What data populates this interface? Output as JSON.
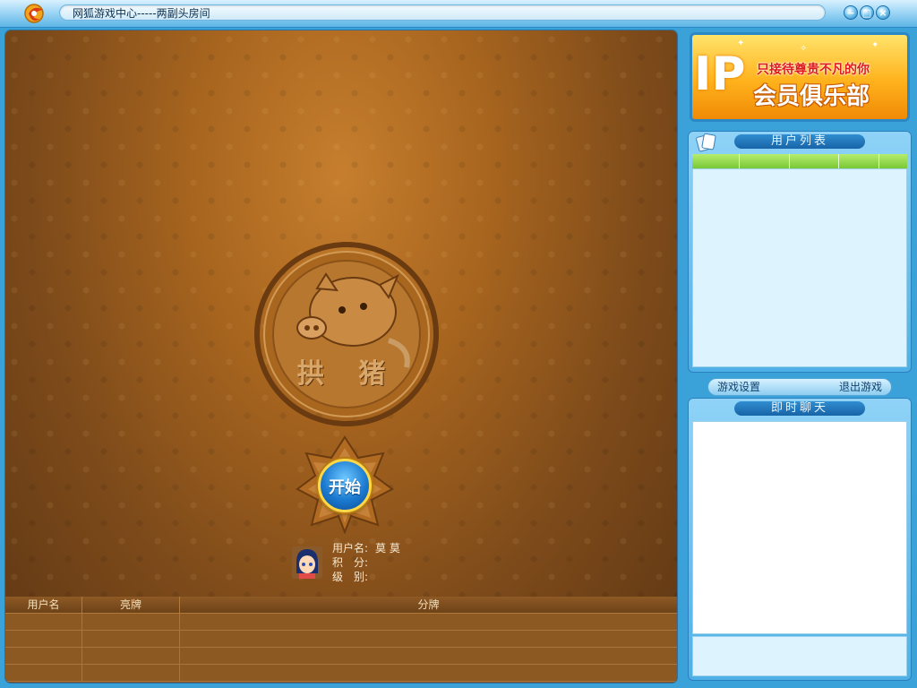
{
  "window": {
    "title": "网狐游戏中心-----两副头房间",
    "minimize_glyph": "−",
    "maximize_glyph": "□",
    "close_glyph": "×"
  },
  "game": {
    "emblem_text": "拱 猪",
    "start_label": "开始"
  },
  "player": {
    "username_label": "用户名:",
    "username_value": "莫 莫",
    "score_label": "积　分:",
    "score_value": "",
    "level_label": "级　别:",
    "level_value": ""
  },
  "score_table": {
    "headers": [
      "用户名",
      "亮牌",
      "分牌"
    ],
    "rows": [
      [
        "",
        "",
        ""
      ],
      [
        "",
        "",
        ""
      ],
      [
        "",
        "",
        ""
      ],
      [
        "",
        "",
        ""
      ]
    ]
  },
  "vip": {
    "big_letters": "IP",
    "tagline": "只接待尊贵不凡的你",
    "club": "会员俱乐部"
  },
  "user_list": {
    "title": "用户列表",
    "columns": [
      "",
      "",
      "",
      "",
      ""
    ]
  },
  "tabs": {
    "game_settings": "游戏设置",
    "exit_game": "退出游戏"
  },
  "chat": {
    "title": "即时聊天"
  },
  "colors": {
    "frame_blue": "#3aa2d8",
    "table_brown": "#a9661f",
    "vip_orange": "#ffb21c",
    "list_green": "#79c836"
  },
  "icons": {
    "app": "fox-app-logo-icon",
    "cards": "playing-cards-icon",
    "pig": "pig-emblem-icon",
    "avatar": "player-avatar-icon"
  }
}
